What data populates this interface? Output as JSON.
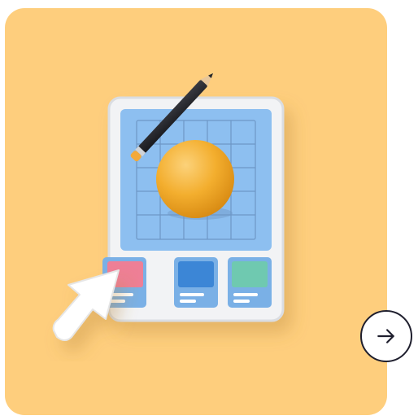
{
  "card": {
    "background_color": "#FECE7D",
    "illustration": "design-tablet-illustration"
  },
  "illustration_colors": {
    "tablet_frame": "#EDEFF2",
    "canvas": "#8DBFF0",
    "grid": "#6E97C6",
    "sphere": "#F3AE2E",
    "swatch_pink": "#EE7F96",
    "swatch_blue": "#3C86D6",
    "swatch_teal": "#6FC9B0",
    "pencil_body": "#2A2B30",
    "pencil_tip": "#F2A93B",
    "cursor": "#FFFFFF"
  },
  "navigation": {
    "next_icon": "arrow-right-icon",
    "accent_color": "#1F1F2E"
  }
}
